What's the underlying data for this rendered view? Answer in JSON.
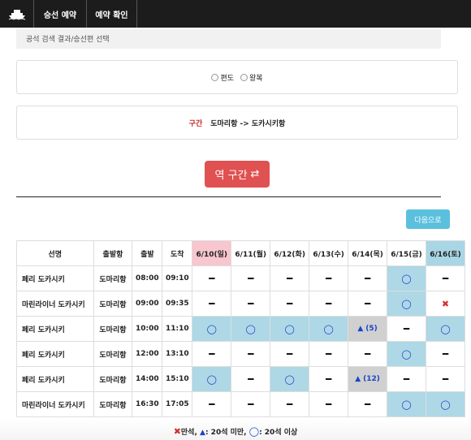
{
  "nav": {
    "logo_icon": "ship-icon",
    "items": [
      {
        "label": "승선 예약"
      },
      {
        "label": "예약 확인"
      }
    ]
  },
  "breadcrumb": "공석 검색 결과/승선편 선택",
  "trip_type": {
    "options": [
      {
        "label": "편도"
      },
      {
        "label": "왕복"
      }
    ]
  },
  "route": {
    "label": "구간",
    "value": "도마리항 -> 도카시키항"
  },
  "reverse_button": {
    "label": "역 구간",
    "icon": "swap-arrows-icon"
  },
  "next_button": {
    "label": "다음으로"
  },
  "colors": {
    "accent_red": "#e05151",
    "next_blue": "#5bc0de",
    "available": "#aed8e6",
    "few_left": "#d0d0d0",
    "sunday": "#f7c6ce",
    "saturday": "#a9d6e5"
  },
  "table": {
    "headers": {
      "vessel": "선명",
      "port": "출발항",
      "departure": "출발",
      "arrival": "도착"
    },
    "dates": [
      {
        "label": "6/10(일)",
        "kind": "sun"
      },
      {
        "label": "6/11(월)",
        "kind": ""
      },
      {
        "label": "6/12(화)",
        "kind": ""
      },
      {
        "label": "6/13(수)",
        "kind": ""
      },
      {
        "label": "6/14(목)",
        "kind": ""
      },
      {
        "label": "6/15(금)",
        "kind": ""
      },
      {
        "label": "6/16(토)",
        "kind": "sat"
      }
    ],
    "rows": [
      {
        "vessel": "페리 도카시키",
        "port": "도마리항",
        "dep": "08:00",
        "arr": "09:10",
        "status": [
          "-",
          "-",
          "-",
          "-",
          "-",
          "o",
          "-"
        ]
      },
      {
        "vessel": "마린라이너 도카시키",
        "port": "도마리항",
        "dep": "09:00",
        "arr": "09:35",
        "status": [
          "-",
          "-",
          "-",
          "-",
          "-",
          "o",
          "x"
        ]
      },
      {
        "vessel": "페리 도카시키",
        "port": "도마리항",
        "dep": "10:00",
        "arr": "11:10",
        "status": [
          "o",
          "o",
          "o",
          "o",
          "t:(5)",
          "-",
          "o"
        ]
      },
      {
        "vessel": "페리 도카시키",
        "port": "도마리항",
        "dep": "12:00",
        "arr": "13:10",
        "status": [
          "-",
          "-",
          "-",
          "-",
          "-",
          "o",
          "-"
        ]
      },
      {
        "vessel": "페리 도카시키",
        "port": "도마리항",
        "dep": "14:00",
        "arr": "15:10",
        "status": [
          "o",
          "-",
          "o",
          "-",
          "t:(12)",
          "-",
          "-"
        ]
      },
      {
        "vessel": "마린라이너 도카시키",
        "port": "도마리항",
        "dep": "16:30",
        "arr": "17:05",
        "status": [
          "-",
          "-",
          "-",
          "-",
          "-",
          "o",
          "o"
        ]
      }
    ]
  },
  "legend": {
    "full": "만석,",
    "few": ": 20석 미만,",
    "many": ": 20석 이상"
  }
}
